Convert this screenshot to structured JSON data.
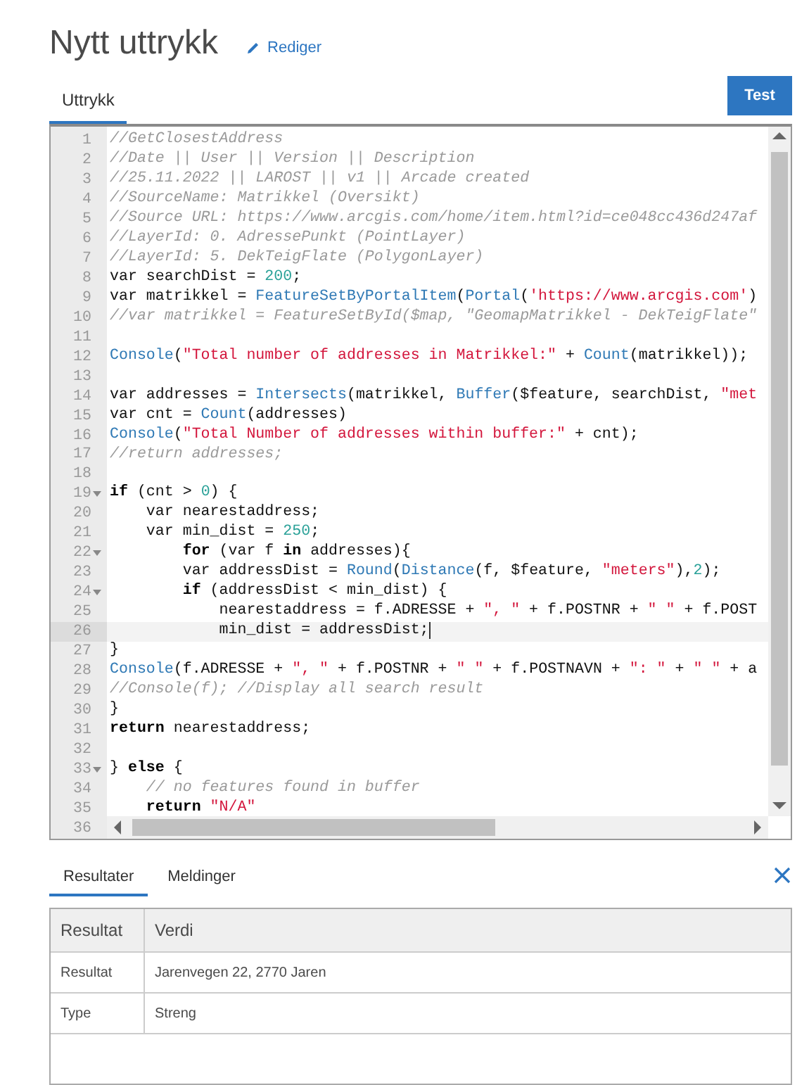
{
  "header": {
    "title": "Nytt uttrykk",
    "edit_link": "Rediger"
  },
  "editor_tabs": [
    {
      "label": "Uttrykk",
      "selected": true
    }
  ],
  "test_button": "Test",
  "code_lines": [
    {
      "number": "1",
      "tokens": [
        {
          "kind": "comment",
          "text": "//GetClosestAddress"
        }
      ]
    },
    {
      "number": "2",
      "tokens": [
        {
          "kind": "comment",
          "text": "//Date || User || Version || Description"
        }
      ]
    },
    {
      "number": "3",
      "tokens": [
        {
          "kind": "comment",
          "text": "//25.11.2022 || LAROST || v1 || Arcade created"
        }
      ]
    },
    {
      "number": "4",
      "tokens": [
        {
          "kind": "comment",
          "text": "//SourceName: Matrikkel (Oversikt)"
        }
      ]
    },
    {
      "number": "5",
      "tokens": [
        {
          "kind": "comment",
          "text": "//Source URL: https://www.arcgis.com/home/item.html?id=ce048cc436d247af"
        }
      ]
    },
    {
      "number": "6",
      "tokens": [
        {
          "kind": "comment",
          "text": "//LayerId: 0. AdressePunkt (PointLayer)"
        }
      ]
    },
    {
      "number": "7",
      "tokens": [
        {
          "kind": "comment",
          "text": "//LayerId: 5. DekTeigFlate (PolygonLayer)"
        }
      ]
    },
    {
      "number": "8",
      "tokens": [
        {
          "kind": "plain",
          "text": "var searchDist = "
        },
        {
          "kind": "number",
          "text": "200"
        },
        {
          "kind": "plain",
          "text": ";"
        }
      ]
    },
    {
      "number": "9",
      "tokens": [
        {
          "kind": "plain",
          "text": "var matrikkel = "
        },
        {
          "kind": "function",
          "text": "FeatureSetByPortalItem"
        },
        {
          "kind": "plain",
          "text": "("
        },
        {
          "kind": "function",
          "text": "Portal"
        },
        {
          "kind": "plain",
          "text": "("
        },
        {
          "kind": "string",
          "text": "'https://www.arcgis.com'"
        },
        {
          "kind": "plain",
          "text": ")"
        }
      ]
    },
    {
      "number": "10",
      "tokens": [
        {
          "kind": "comment",
          "text": "//var matrikkel = FeatureSetById($map, \"GeomapMatrikkel - DekTeigFlate\""
        }
      ]
    },
    {
      "number": "11"
    },
    {
      "number": "12",
      "tokens": [
        {
          "kind": "function",
          "text": "Console"
        },
        {
          "kind": "plain",
          "text": "("
        },
        {
          "kind": "string",
          "text": "\"Total number of addresses in Matrikkel:\""
        },
        {
          "kind": "plain",
          "text": " + "
        },
        {
          "kind": "function",
          "text": "Count"
        },
        {
          "kind": "plain",
          "text": "(matrikkel));"
        }
      ]
    },
    {
      "number": "13"
    },
    {
      "number": "14",
      "tokens": [
        {
          "kind": "plain",
          "text": "var addresses = "
        },
        {
          "kind": "function",
          "text": "Intersects"
        },
        {
          "kind": "plain",
          "text": "(matrikkel, "
        },
        {
          "kind": "function",
          "text": "Buffer"
        },
        {
          "kind": "plain",
          "text": "($feature, searchDist, "
        },
        {
          "kind": "string",
          "text": "\"met"
        }
      ]
    },
    {
      "number": "15",
      "tokens": [
        {
          "kind": "plain",
          "text": "var cnt = "
        },
        {
          "kind": "function",
          "text": "Count"
        },
        {
          "kind": "plain",
          "text": "(addresses)"
        }
      ]
    },
    {
      "number": "16",
      "tokens": [
        {
          "kind": "function",
          "text": "Console"
        },
        {
          "kind": "plain",
          "text": "("
        },
        {
          "kind": "string",
          "text": "\"Total Number of addresses within buffer:\""
        },
        {
          "kind": "plain",
          "text": " + cnt);"
        }
      ]
    },
    {
      "number": "17",
      "tokens": [
        {
          "kind": "comment",
          "text": "//return addresses;"
        }
      ]
    },
    {
      "number": "18"
    },
    {
      "number": "19",
      "foldable": true,
      "tokens": [
        {
          "kind": "keyword",
          "text": "if"
        },
        {
          "kind": "plain",
          "text": " (cnt > "
        },
        {
          "kind": "number",
          "text": "0"
        },
        {
          "kind": "plain",
          "text": ") {"
        }
      ]
    },
    {
      "number": "20",
      "tokens": [
        {
          "kind": "plain",
          "text": "    var nearestaddress;"
        }
      ]
    },
    {
      "number": "21",
      "tokens": [
        {
          "kind": "plain",
          "text": "    var min_dist = "
        },
        {
          "kind": "number",
          "text": "250"
        },
        {
          "kind": "plain",
          "text": ";"
        }
      ]
    },
    {
      "number": "22",
      "foldable": true,
      "tokens": [
        {
          "kind": "keyword",
          "text": "        for"
        },
        {
          "kind": "plain",
          "text": " (var f "
        },
        {
          "kind": "keyword",
          "text": "in"
        },
        {
          "kind": "plain",
          "text": " addresses){"
        }
      ]
    },
    {
      "number": "23",
      "tokens": [
        {
          "kind": "plain",
          "text": "        var addressDist = "
        },
        {
          "kind": "function",
          "text": "Round"
        },
        {
          "kind": "plain",
          "text": "("
        },
        {
          "kind": "function",
          "text": "Distance"
        },
        {
          "kind": "plain",
          "text": "(f, $feature, "
        },
        {
          "kind": "string",
          "text": "\"meters\""
        },
        {
          "kind": "plain",
          "text": "),"
        },
        {
          "kind": "number",
          "text": "2"
        },
        {
          "kind": "plain",
          "text": ");"
        }
      ]
    },
    {
      "number": "24",
      "foldable": true,
      "tokens": [
        {
          "kind": "keyword",
          "text": "        if"
        },
        {
          "kind": "plain",
          "text": " (addressDist < min_dist) {"
        }
      ]
    },
    {
      "number": "25",
      "tokens": [
        {
          "kind": "plain",
          "text": "            nearestaddress = f.ADRESSE + "
        },
        {
          "kind": "string",
          "text": "\", \""
        },
        {
          "kind": "plain",
          "text": " + f.POSTNR + "
        },
        {
          "kind": "string",
          "text": "\" \""
        },
        {
          "kind": "plain",
          "text": " + f.POST"
        }
      ]
    },
    {
      "number": "26",
      "active": true,
      "tokens": [
        {
          "kind": "plain",
          "text": "            min_dist = addressDist;"
        }
      ]
    },
    {
      "number": "27",
      "tokens": [
        {
          "kind": "plain",
          "text": "}"
        }
      ]
    },
    {
      "number": "28",
      "tokens": [
        {
          "kind": "function",
          "text": "Console"
        },
        {
          "kind": "plain",
          "text": "(f.ADRESSE + "
        },
        {
          "kind": "string",
          "text": "\", \""
        },
        {
          "kind": "plain",
          "text": " + f.POSTNR + "
        },
        {
          "kind": "string",
          "text": "\" \""
        },
        {
          "kind": "plain",
          "text": " + f.POSTNAVN + "
        },
        {
          "kind": "string",
          "text": "\": \""
        },
        {
          "kind": "plain",
          "text": " + "
        },
        {
          "kind": "string",
          "text": "\" \""
        },
        {
          "kind": "plain",
          "text": " + a"
        }
      ]
    },
    {
      "number": "29",
      "tokens": [
        {
          "kind": "comment",
          "text": "//Console(f); //Display all search result"
        }
      ]
    },
    {
      "number": "30",
      "tokens": [
        {
          "kind": "plain",
          "text": "}"
        }
      ]
    },
    {
      "number": "31",
      "tokens": [
        {
          "kind": "keyword",
          "text": "return"
        },
        {
          "kind": "plain",
          "text": " nearestaddress;"
        }
      ]
    },
    {
      "number": "32"
    },
    {
      "number": "33",
      "foldable": true,
      "tokens": [
        {
          "kind": "plain",
          "text": "} "
        },
        {
          "kind": "keyword",
          "text": "else"
        },
        {
          "kind": "plain",
          "text": " {"
        }
      ]
    },
    {
      "number": "34",
      "tokens": [
        {
          "kind": "comment",
          "text": "    // no features found in buffer"
        }
      ]
    },
    {
      "number": "35",
      "tokens": [
        {
          "kind": "keyword",
          "text": "    return"
        },
        {
          "kind": "string",
          "text": " \"N/A\""
        }
      ]
    },
    {
      "number": "36"
    }
  ],
  "result_tabs": [
    {
      "label": "Resultater",
      "selected": true
    },
    {
      "label": "Meldinger",
      "selected": false
    }
  ],
  "result_table": {
    "columns": [
      "Resultat",
      "Verdi"
    ],
    "rows": [
      [
        "Resultat",
        "Jarenvegen 22, 2770 Jaren"
      ],
      [
        "Type",
        "Streng"
      ]
    ]
  }
}
